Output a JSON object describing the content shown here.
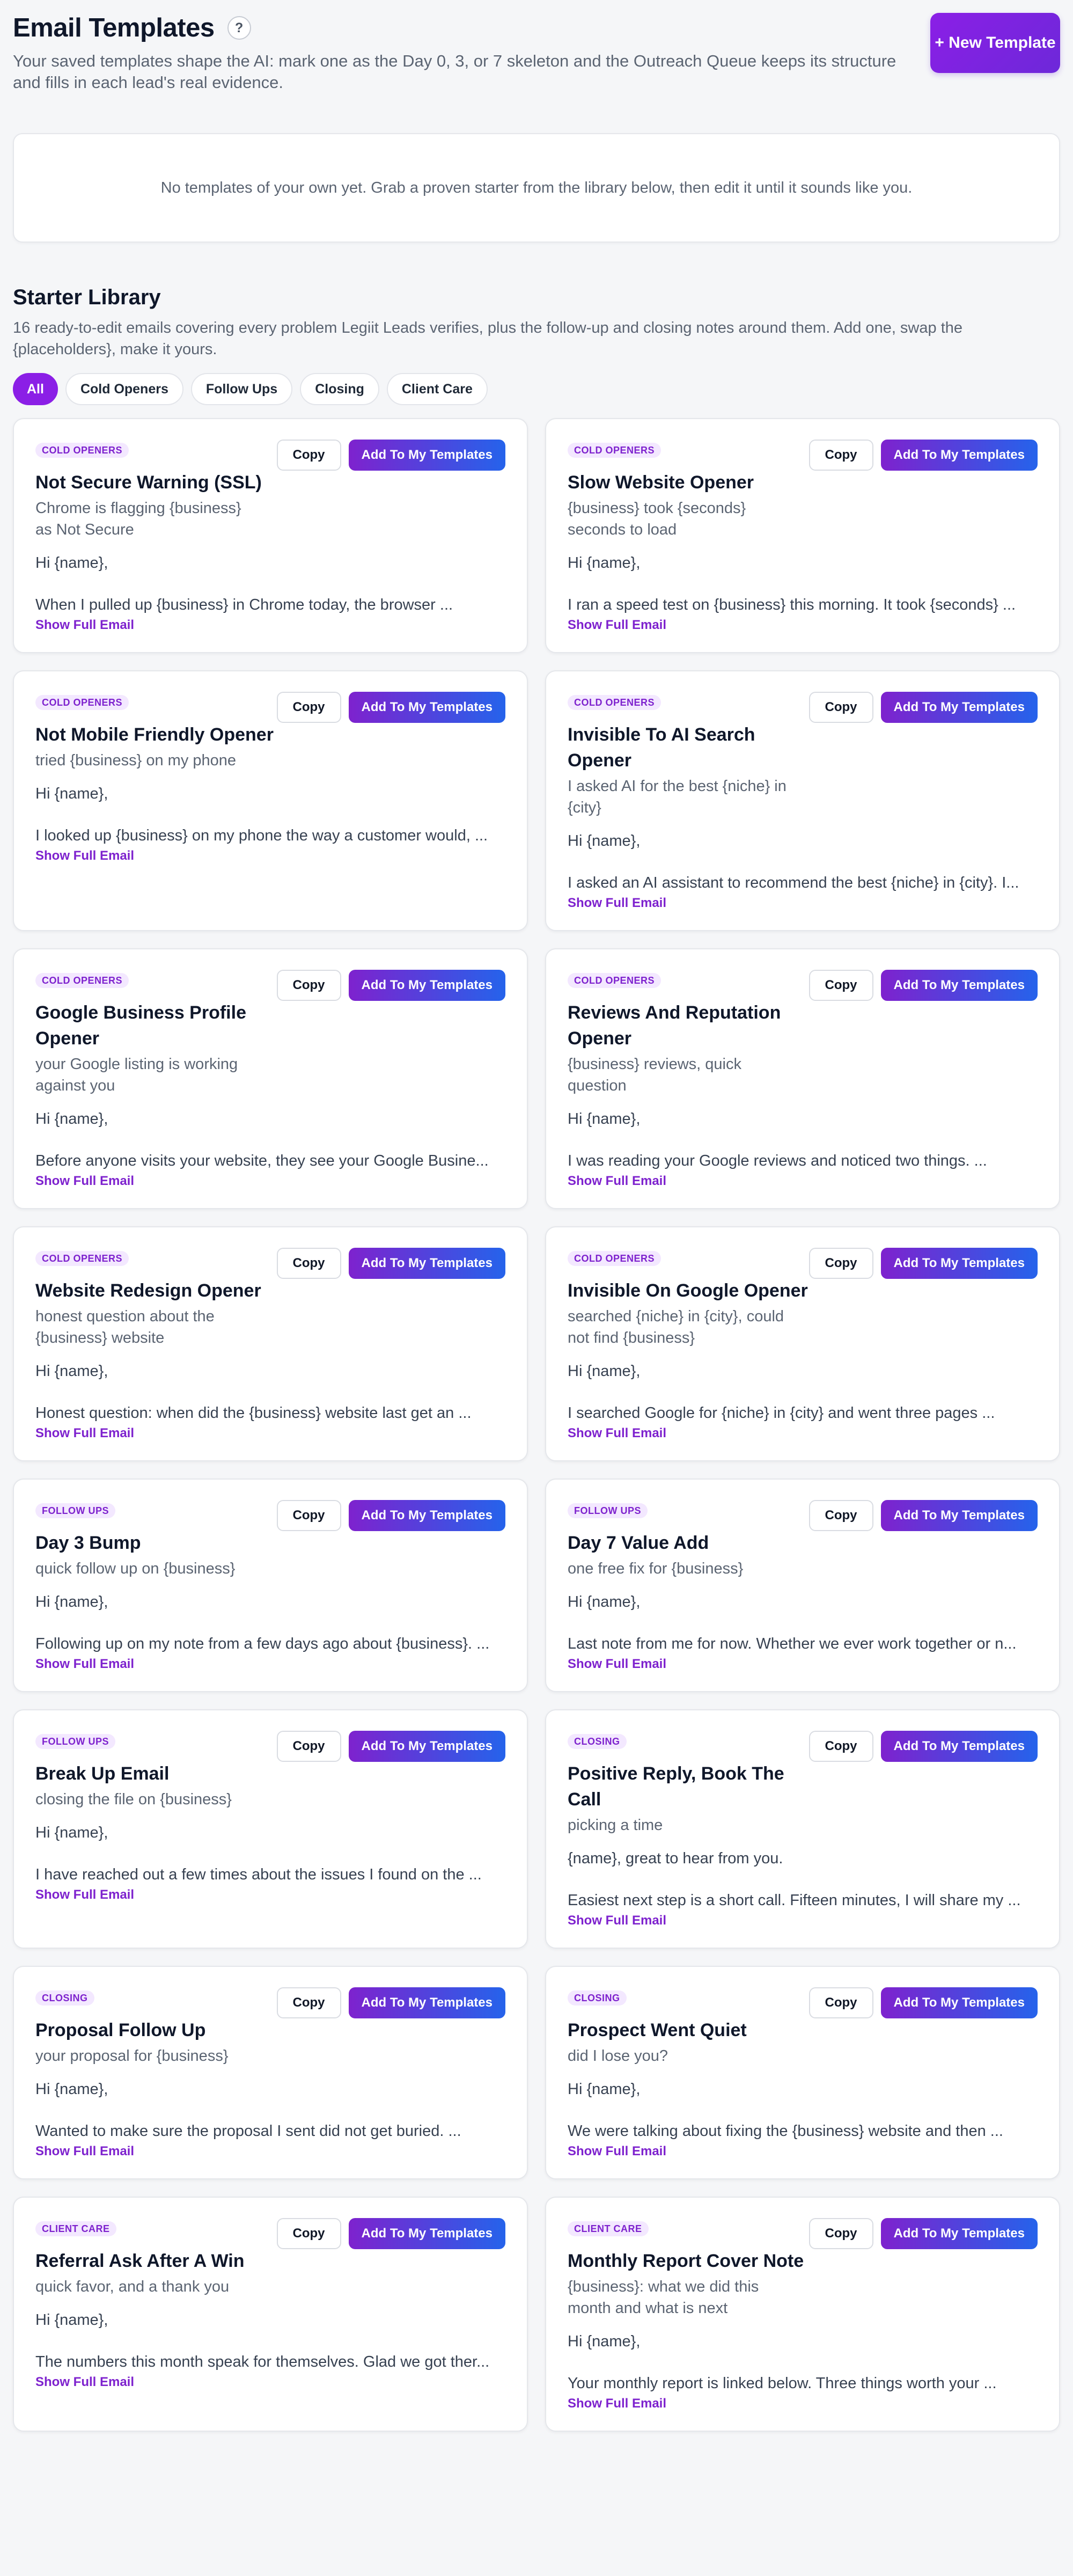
{
  "header": {
    "title": "Email Templates",
    "help_icon": "question-mark-icon",
    "help_glyph": "?",
    "subtitle": "Your saved templates shape the AI: mark one as the Day 0, 3, or 7 skeleton and the Outreach Queue keeps its structure and fills in each lead's real evidence.",
    "new_template_label": "+ New Template"
  },
  "empty_state": "No templates of your own yet. Grab a proven starter from the library below, then edit it until it sounds like you.",
  "library": {
    "title": "Starter Library",
    "subtitle": "16 ready-to-edit emails covering every problem Legiit Leads verifies, plus the follow-up and closing notes around them. Add one, swap the {placeholders}, make it yours.",
    "filters": [
      "All",
      "Cold Openers",
      "Follow Ups",
      "Closing",
      "Client Care"
    ],
    "active_filter": "All",
    "copy_label": "Copy",
    "add_label": "Add To My Templates",
    "show_full_label": "Show Full Email",
    "colors": {
      "accent": "#8b1fe6",
      "badge_bg": "#f3e8ff",
      "badge_text": "#7e22ce",
      "gradient_end": "#2563eb"
    },
    "templates": [
      {
        "category": "COLD OPENERS",
        "name": "Not Secure Warning (SSL)",
        "subject": "Chrome is flagging {business} as Not Secure",
        "greeting": "Hi {name},",
        "preview": "When I pulled up {business} in Chrome today, the browser ..."
      },
      {
        "category": "COLD OPENERS",
        "name": "Slow Website Opener",
        "subject": "{business} took {seconds} seconds to load",
        "greeting": "Hi {name},",
        "preview": "I ran a speed test on {business} this morning. It took {seconds} ..."
      },
      {
        "category": "COLD OPENERS",
        "name": "Not Mobile Friendly Opener",
        "subject": "tried {business} on my phone",
        "greeting": "Hi {name},",
        "preview": "I looked up {business} on my phone the way a customer would, ..."
      },
      {
        "category": "COLD OPENERS",
        "name": "Invisible To AI Search Opener",
        "subject": "I asked AI for the best {niche} in {city}",
        "greeting": "Hi {name},",
        "preview": "I asked an AI assistant to recommend the best {niche} in {city}. I..."
      },
      {
        "category": "COLD OPENERS",
        "name": "Google Business Profile Opener",
        "subject": "your Google listing is working against you",
        "greeting": "Hi {name},",
        "preview": "Before anyone visits your website, they see your Google Busine..."
      },
      {
        "category": "COLD OPENERS",
        "name": "Reviews And Reputation Opener",
        "subject": "{business} reviews, quick question",
        "greeting": "Hi {name},",
        "preview": "I was reading your Google reviews and noticed two things. ..."
      },
      {
        "category": "COLD OPENERS",
        "name": "Website Redesign Opener",
        "subject": "honest question about the {business} website",
        "greeting": "Hi {name},",
        "preview": "Honest question: when did the {business} website last get an ..."
      },
      {
        "category": "COLD OPENERS",
        "name": "Invisible On Google Opener",
        "subject": "searched {niche} in {city}, could not find {business}",
        "greeting": "Hi {name},",
        "preview": "I searched Google for {niche} in {city} and went three pages ..."
      },
      {
        "category": "FOLLOW UPS",
        "name": "Day 3 Bump",
        "subject": "quick follow up on {business}",
        "greeting": "Hi {name},",
        "preview": "Following up on my note from a few days ago about {business}. ..."
      },
      {
        "category": "FOLLOW UPS",
        "name": "Day 7 Value Add",
        "subject": "one free fix for {business}",
        "greeting": "Hi {name},",
        "preview": "Last note from me for now. Whether we ever work together or n..."
      },
      {
        "category": "FOLLOW UPS",
        "name": "Break Up Email",
        "subject": "closing the file on {business}",
        "greeting": "Hi {name},",
        "preview": "I have reached out a few times about the issues I found on the ..."
      },
      {
        "category": "CLOSING",
        "name": "Positive Reply, Book The Call",
        "subject": "picking a time",
        "greeting": "{name}, great to hear from you.",
        "preview": "Easiest next step is a short call. Fifteen minutes, I will share my ..."
      },
      {
        "category": "CLOSING",
        "name": "Proposal Follow Up",
        "subject": "your proposal for {business}",
        "greeting": "Hi {name},",
        "preview": "Wanted to make sure the proposal I sent did not get buried. ..."
      },
      {
        "category": "CLOSING",
        "name": "Prospect Went Quiet",
        "subject": "did I lose you?",
        "greeting": "Hi {name},",
        "preview": "We were talking about fixing the {business} website and then ..."
      },
      {
        "category": "CLIENT CARE",
        "name": "Referral Ask After A Win",
        "subject": "quick favor, and a thank you",
        "greeting": "Hi {name},",
        "preview": "The numbers this month speak for themselves. Glad we got ther..."
      },
      {
        "category": "CLIENT CARE",
        "name": "Monthly Report Cover Note",
        "subject": "{business}: what we did this month and what is next",
        "greeting": "Hi {name},",
        "preview": "Your monthly report is linked below. Three things worth your ..."
      }
    ]
  }
}
